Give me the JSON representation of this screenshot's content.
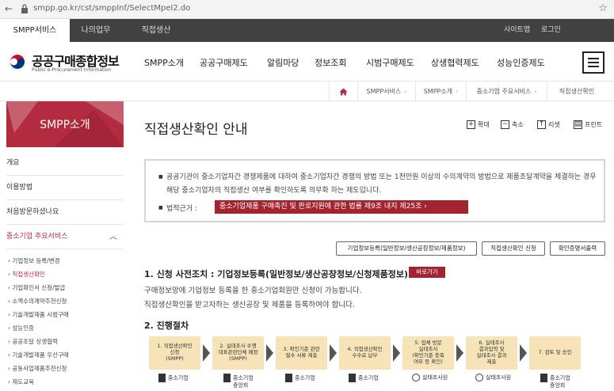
{
  "browser": {
    "url": "smpp.go.kr/cst/smppInf/SelectMpeI2.do"
  },
  "topnav": {
    "tabs": [
      "SMPP서비스",
      "나의업무",
      "직접생산"
    ],
    "util": [
      "사이트맵",
      "로그인"
    ]
  },
  "header": {
    "logo_title": "공공구매종합정보",
    "logo_sub": "Public e-Procurement Information",
    "gnb": [
      "SMPP소개",
      "공공구매제도",
      "알림마당",
      "정보조회",
      "시범구매제도",
      "상생협력제도",
      "성능인증제도"
    ]
  },
  "breadcrumb": [
    "SMPP서비스",
    "SMPP소개",
    "중소기업 주요서비스",
    "직접생산확인"
  ],
  "sidebar": {
    "banner": "SMPP소개",
    "items": [
      "개요",
      "이용방법",
      "처음방문하셨나요",
      "중소기업 주요서비스"
    ],
    "sub_items": [
      "기업정보 등록/변경",
      "직접생산확인",
      "기업확인서 신청/발급",
      "소액수의계약추천신청",
      "기술개발제품 시범구매",
      "성능인증",
      "공공조달 상생협력",
      "기술개발제품 우선구매",
      "공동사업제품추천신청",
      "제도교육"
    ]
  },
  "content": {
    "title": "직접생산확인 안내",
    "tools": [
      "확대",
      "축소",
      "리셋",
      "프린트"
    ],
    "info_text": "공공기관이 중소기업자간 경쟁제품에 대하여 중소기업자간 경쟁의 방법 또는 1천만원 이상의 수의계약의 방법으로 제품조달계약을 체결하는 경우 해당 중소기업자의 직접생산 여부를 확인하도록 의무화 하는 제도입니다.",
    "law_label": "법적근거 :",
    "law_button": "중소기업제품 구매촉진 및 판로지원에 관한 법률 제9조 내지 제25조",
    "buttons": [
      "기업정보등록(일반정보/생산공장정보/제품정보)",
      "직접생산확인 신청",
      "확인증명서출력"
    ],
    "section1_title": "1. 신청 사전조치 : 기업정보등록(일반정보/생산공장정보/신청제품정보)",
    "go_button": "바로가기",
    "desc1": "구매정보망에 기업정보 등록을 한 중소기업회원만 신청이 가능합니다.",
    "desc2": "직접생산확인을 받고자하는 생산공장 및 제품을 등록하여야 합니다.",
    "section2_title": "2. 진행절차",
    "steps": [
      {
        "l1": "1. 직접생산확인",
        "l2": "신청",
        "l3": "(SMPP)"
      },
      {
        "l1": "2. 실태조사 수행",
        "l2": "대표관련단체 배정",
        "l3": "(SMPP)"
      },
      {
        "l1": "3. 확인기준 관련",
        "l2": "필수 서류 제출",
        "l3": ""
      },
      {
        "l1": "4. 직접생산확인",
        "l2": "수수료 납부",
        "l3": ""
      },
      {
        "l1": "5. 업체 방문",
        "l2": "실태조사",
        "l3": "(확인기준 충족",
        "l4": "여부 등 확인)"
      },
      {
        "l1": "6. 실태조사",
        "l2": "결과입력 및",
        "l3": "실태조사 결과",
        "l4": "제출"
      },
      {
        "l1": "7. 검토 및 승인",
        "l2": "",
        "l3": ""
      }
    ],
    "actors": [
      {
        "name": "중소기업",
        "line2": ""
      },
      {
        "name": "중소기업",
        "line2": "중앙회"
      },
      {
        "name": "중소기업",
        "line2": ""
      },
      {
        "name": "중소기업",
        "line2": ""
      },
      {
        "name": "실태조사원",
        "line2": ""
      },
      {
        "name": "실태조사원",
        "line2": ""
      },
      {
        "name": "중소기업",
        "line2": "중앙회"
      }
    ]
  }
}
